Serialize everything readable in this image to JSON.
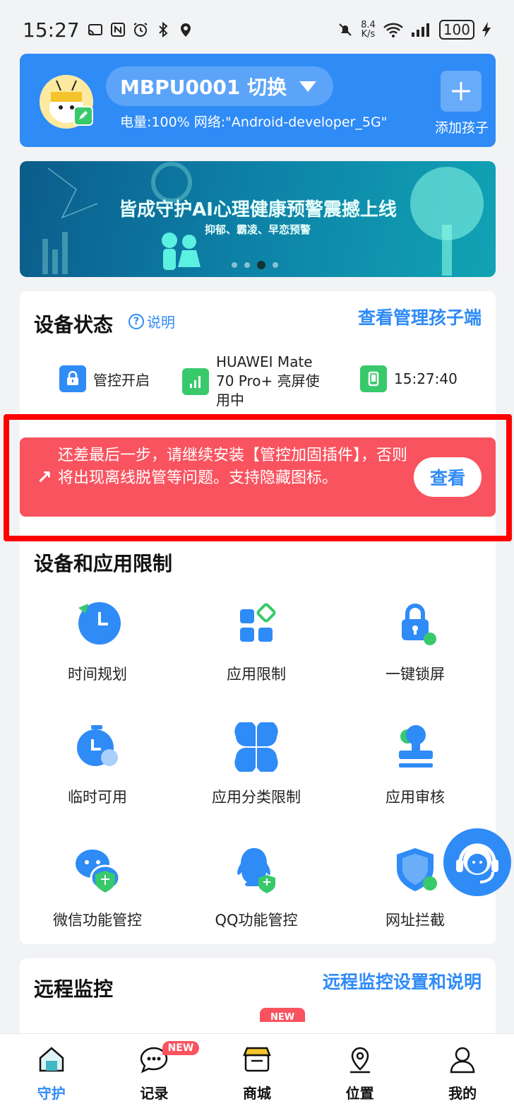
{
  "status_bar": {
    "time": "15:27",
    "net_speed_value": "8.4",
    "net_speed_unit": "K/s",
    "battery": "100"
  },
  "header": {
    "device_name": "MBPU0001 切换",
    "device_info": "电量:100% 网络:\"Android-developer_5G\"",
    "add_child_label": "添加孩子"
  },
  "banner": {
    "title": "皆成守护AI心理健康预警震撼上线",
    "subtitle": "抑郁、霸凌、早恋预警"
  },
  "device_status": {
    "title": "设备状态",
    "help_label": "说明",
    "view_child_link": "查看管理孩子端",
    "items": [
      {
        "label": "管控开启",
        "color": "#2f8bf6"
      },
      {
        "label": "HUAWEI Mate 70 Pro+ 亮屏使用中",
        "color": "#38c96b"
      },
      {
        "label": "15:27:40",
        "color": "#38c96b"
      }
    ]
  },
  "warning": {
    "text": "还差最后一步，请继续安装【管控加固插件】，否则将出现离线脱管等问题。支持隐藏图标。",
    "button": "查看",
    "color": "#f9535f"
  },
  "restrictions": {
    "title": "设备和应用限制",
    "items": [
      {
        "label": "时间规划",
        "icon": "clock-icon"
      },
      {
        "label": "应用限制",
        "icon": "apps-icon"
      },
      {
        "label": "一键锁屏",
        "icon": "lock-icon"
      },
      {
        "label": "临时可用",
        "icon": "timer-icon"
      },
      {
        "label": "应用分类限制",
        "icon": "clover-icon"
      },
      {
        "label": "应用审核",
        "icon": "stamp-icon"
      },
      {
        "label": "微信功能管控",
        "icon": "wechat-icon"
      },
      {
        "label": "QQ功能管控",
        "icon": "qq-icon"
      },
      {
        "label": "网址拦截",
        "icon": "shield-icon"
      }
    ]
  },
  "remote": {
    "title": "远程监控",
    "link": "远程监控设置和说明",
    "new_tag": "NEW"
  },
  "tabbar": {
    "tabs": [
      {
        "label": "守护",
        "icon": "home-icon",
        "active": true
      },
      {
        "label": "记录",
        "icon": "chat-icon",
        "badge": "NEW"
      },
      {
        "label": "商城",
        "icon": "shop-icon"
      },
      {
        "label": "位置",
        "icon": "location-icon"
      },
      {
        "label": "我的",
        "icon": "person-icon"
      }
    ]
  },
  "colors": {
    "accent": "#2f8bf6",
    "green": "#38c96b",
    "alert": "#f9535f"
  }
}
